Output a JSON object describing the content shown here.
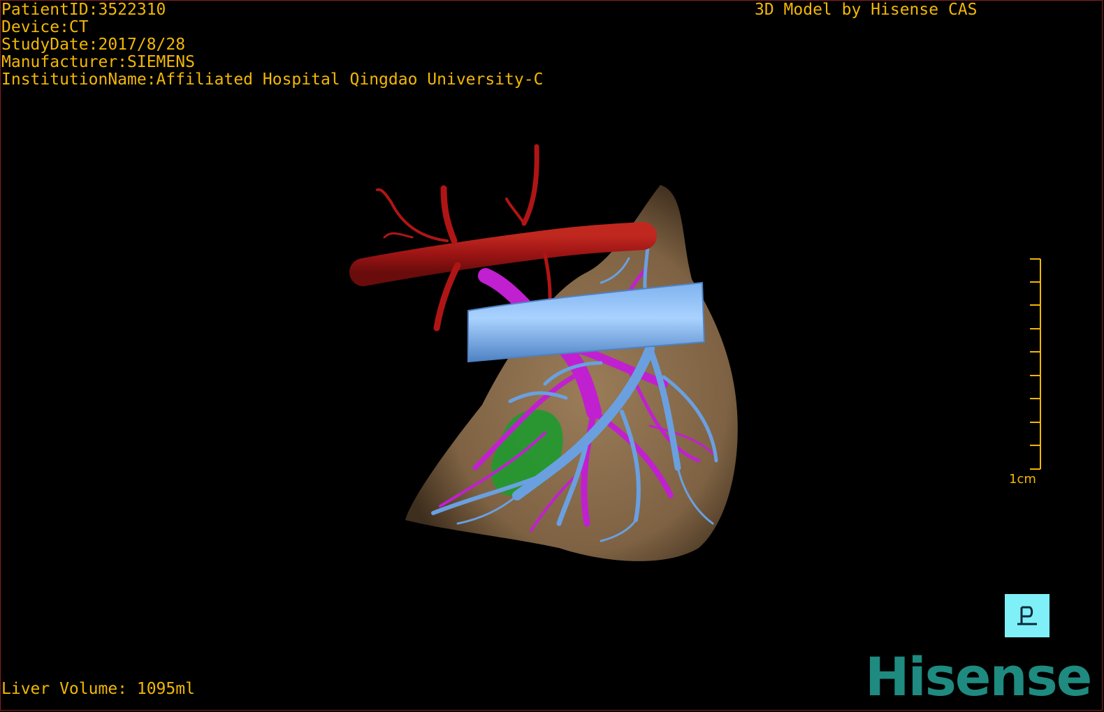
{
  "patient_info": {
    "patient_id": "PatientID:3522310",
    "device": "Device:CT",
    "study_date": "StudyDate:2017/8/28",
    "manufacturer": "Manufacturer:SIEMENS",
    "institution": "InstitutionName:Affiliated Hospital Qingdao University-C"
  },
  "header": {
    "model_title": "3D Model by Hisense CAS"
  },
  "footer": {
    "liver_volume": "Liver Volume: 1095ml"
  },
  "scale_bar": {
    "label": "1cm"
  },
  "logo": {
    "text": "Hisense"
  },
  "colors": {
    "overlay_text": "#f2b705",
    "liver": "#8b6e4e",
    "artery": "#b01515",
    "portal_vein": "#c020d0",
    "hepatic_vein": "#6aa0e0",
    "gallbladder": "#1f9a2f",
    "orientation_button": "#7ff0f7",
    "logo": "#1f8a80"
  }
}
